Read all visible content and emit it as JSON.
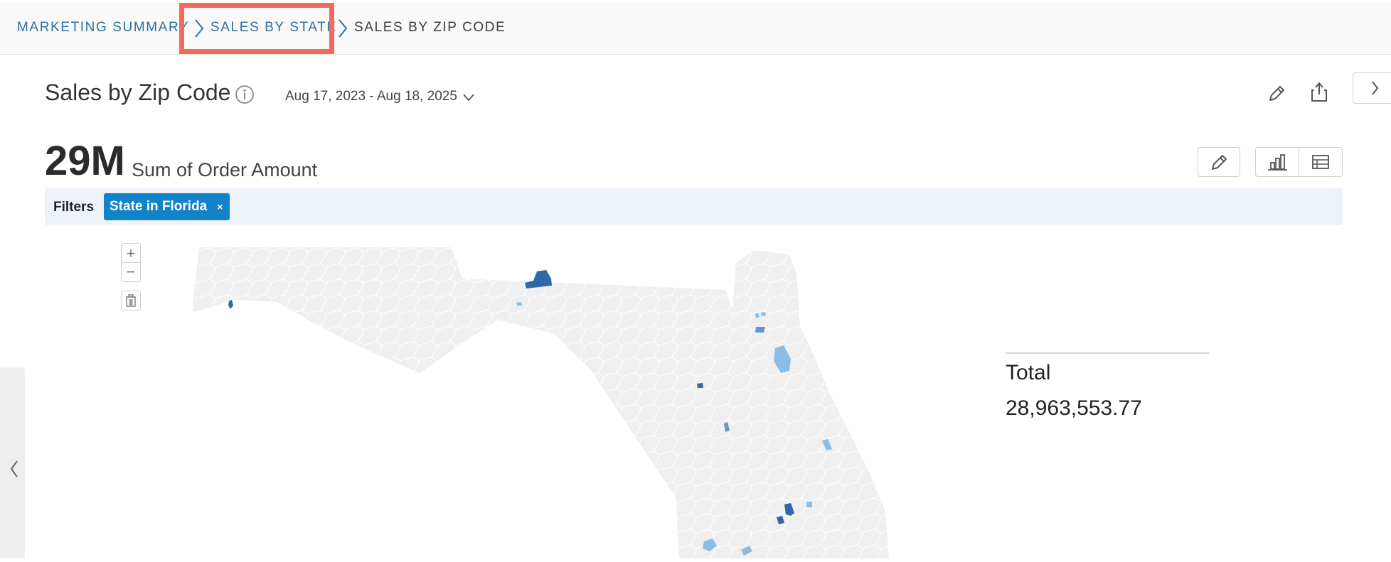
{
  "breadcrumb": {
    "items": [
      {
        "label": "MARKETING SUMMARY"
      },
      {
        "label": "SALES BY STATE"
      },
      {
        "label": "SALES BY ZIP CODE"
      }
    ]
  },
  "header": {
    "title": "Sales by Zip Code",
    "date_range": "Aug 17, 2023 - Aug 18, 2025"
  },
  "metric": {
    "value": "29M",
    "label": "Sum of Order Amount"
  },
  "filters": {
    "label": "Filters",
    "chips": [
      {
        "label": "State in Florida",
        "remove": "×"
      }
    ]
  },
  "map_controls": {
    "zoom_in": "+",
    "zoom_out": "−"
  },
  "total": {
    "label": "Total",
    "value": "28,963,553.77"
  },
  "colors": {
    "accent": "#1083c9",
    "link": "#2f6f9f",
    "highlight": "#f26a5c",
    "map_base": "#efefef",
    "map_dark": "#2f6aa6",
    "map_light": "#8bbde3"
  },
  "icons": [
    "chevron-right-icon",
    "info-icon",
    "chevron-down-icon",
    "pencil-icon",
    "share-icon",
    "bar-chart-icon",
    "table-icon",
    "building-icon",
    "chevron-left-icon"
  ]
}
